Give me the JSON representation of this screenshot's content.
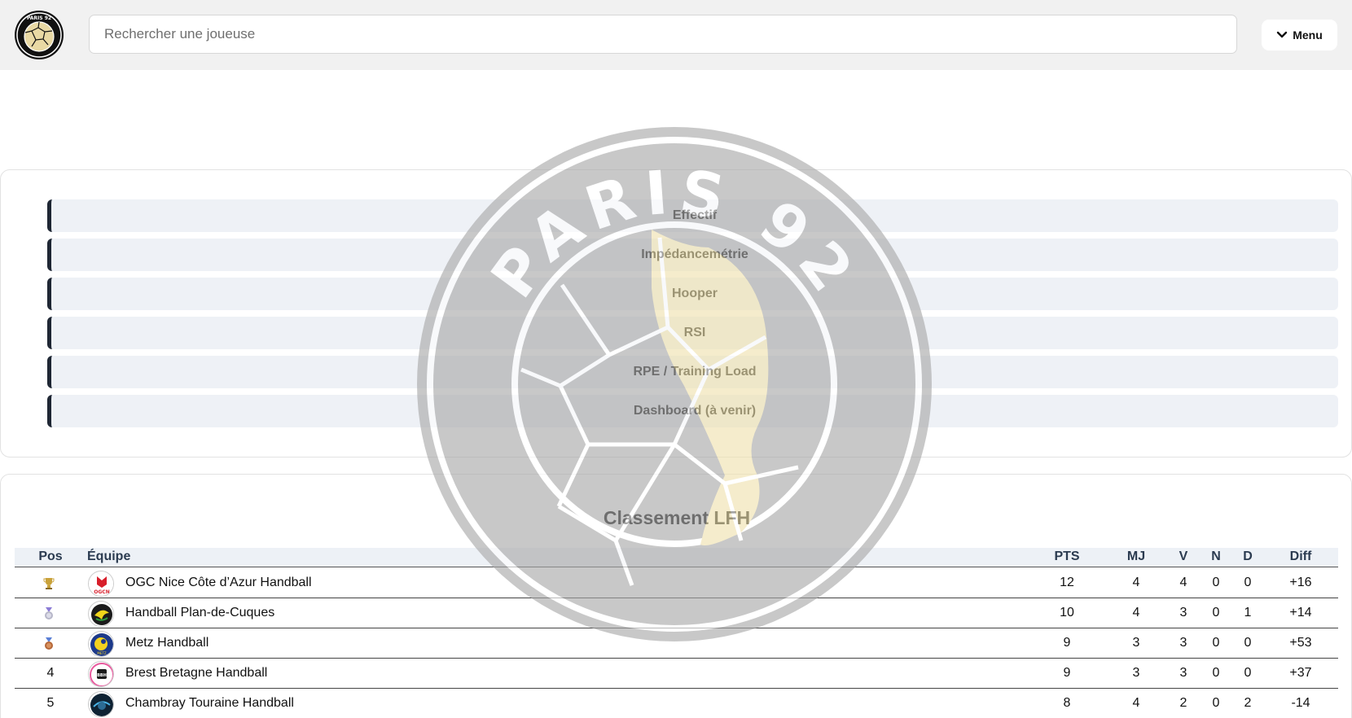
{
  "header": {
    "logo_text": "PARIS 92",
    "search_placeholder": "Rechercher une joueuse",
    "menu_label": "Menu"
  },
  "nav": {
    "items": [
      {
        "label": "Effectif"
      },
      {
        "label": "Impédancemétrie"
      },
      {
        "label": "Hooper"
      },
      {
        "label": "RSI"
      },
      {
        "label": "RPE / Training Load"
      },
      {
        "label": "Dashboard (à venir)"
      }
    ]
  },
  "standings": {
    "title": "Classement LFH",
    "columns": [
      "Pos",
      "Équipe",
      "PTS",
      "MJ",
      "V",
      "N",
      "D",
      "Diff"
    ],
    "rows": [
      {
        "pos": "",
        "medal": "gold-trophy-icon",
        "team": "OGC Nice Côte d’Azur Handball",
        "pts": "12",
        "mj": "4",
        "v": "4",
        "n": "0",
        "d": "0",
        "diff": "+16"
      },
      {
        "pos": "",
        "medal": "silver-medal-icon",
        "team": "Handball Plan-de-Cuques",
        "pts": "10",
        "mj": "4",
        "v": "3",
        "n": "0",
        "d": "1",
        "diff": "+14"
      },
      {
        "pos": "",
        "medal": "bronze-medal-icon",
        "team": "Metz Handball",
        "pts": "9",
        "mj": "3",
        "v": "3",
        "n": "0",
        "d": "0",
        "diff": "+53"
      },
      {
        "pos": "4",
        "medal": "",
        "team": "Brest Bretagne Handball",
        "pts": "9",
        "mj": "3",
        "v": "3",
        "n": "0",
        "d": "0",
        "diff": "+37"
      },
      {
        "pos": "5",
        "medal": "",
        "team": "Chambray Touraine Handball",
        "pts": "8",
        "mj": "4",
        "v": "2",
        "n": "0",
        "d": "2",
        "diff": "-14"
      }
    ]
  },
  "colors": {
    "topbar_bg": "#f1f1f1",
    "nav_item_bg": "#eef1f6",
    "nav_accent": "#1e2633",
    "header_text": "#2b3b50",
    "gold": "#c9a23a",
    "silver": "#b7b7c9",
    "bronze": "#b5683a"
  }
}
